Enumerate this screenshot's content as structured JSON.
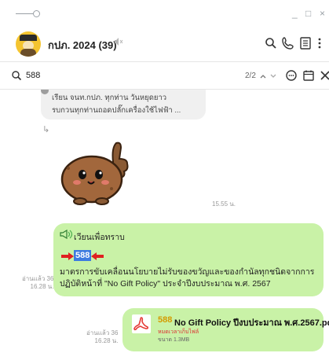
{
  "window": {
    "minimize_label": "_",
    "maximize_label": "□",
    "close_label": "×"
  },
  "header": {
    "chat_title": "กปภ. 2024 (39)",
    "mute_icon": "speaker-muted-icon"
  },
  "search": {
    "value": "588",
    "result_count": "2/2",
    "up_arrow": "^",
    "down_arrow": "v"
  },
  "messages": {
    "reply_preview": {
      "line1": "เรียน จนท.กปภ. ทุกท่าน วันหยุดยาว",
      "line2": "รบกวนทุกท่านถอดปลั๊กเครื่องใช้ไฟฟ้า ..."
    },
    "reply_arrow": "↳",
    "sticker_time": "15.55 น.",
    "announce": {
      "header": "เวียนเพื่อทราบ",
      "highlight_number": "588",
      "body": "มาตรการขับเคลื่อนนโยบายไม่รับของขวัญและของกำนัลทุกชนิดจากการปฏิบัติหน้าที่ \"No Gift Policy\" ประจำปีงบประมาณ พ.ศ. 2567",
      "read_count": "อ่านแล้ว 36",
      "time": "16.28 น."
    },
    "file": {
      "name_number": "588",
      "name": "No Gift Policy  ปีงบประมาณ พ.ศ.2567.pdf",
      "expiry": "หมดเวลาเก็บไฟล์",
      "size": "ขนาด 1.3MB",
      "read_count": "อ่านแล้ว 36",
      "time": "16.28 น."
    }
  },
  "colors": {
    "bubble_green": "#c9f2a7",
    "highlight_blue": "#3d7be0",
    "arrow_red": "#e02020",
    "pdf_red": "#e53935"
  }
}
